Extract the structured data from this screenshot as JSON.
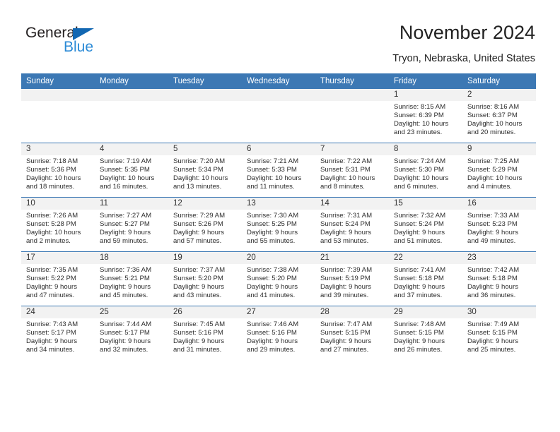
{
  "brand": {
    "name_part1": "General",
    "name_part2": "Blue",
    "triangle_icon": "triangle-icon",
    "accent_color": "#1267b2",
    "secondary_color": "#2b8ad6"
  },
  "header": {
    "title": "November 2024",
    "subtitle": "Tryon, Nebraska, United States"
  },
  "theme": {
    "header_blue": "#3c78b4",
    "day_strip_gray": "#f2f2f2",
    "text_color": "#2d2d2d"
  },
  "weekdays": [
    "Sunday",
    "Monday",
    "Tuesday",
    "Wednesday",
    "Thursday",
    "Friday",
    "Saturday"
  ],
  "weeks": [
    [
      {
        "day": "",
        "sunrise": "",
        "sunset": "",
        "daylight_line1": "",
        "daylight_line2": "",
        "empty": true
      },
      {
        "day": "",
        "sunrise": "",
        "sunset": "",
        "daylight_line1": "",
        "daylight_line2": "",
        "empty": true
      },
      {
        "day": "",
        "sunrise": "",
        "sunset": "",
        "daylight_line1": "",
        "daylight_line2": "",
        "empty": true
      },
      {
        "day": "",
        "sunrise": "",
        "sunset": "",
        "daylight_line1": "",
        "daylight_line2": "",
        "empty": true
      },
      {
        "day": "",
        "sunrise": "",
        "sunset": "",
        "daylight_line1": "",
        "daylight_line2": "",
        "empty": true
      },
      {
        "day": "1",
        "sunrise": "Sunrise: 8:15 AM",
        "sunset": "Sunset: 6:39 PM",
        "daylight_line1": "Daylight: 10 hours",
        "daylight_line2": "and 23 minutes."
      },
      {
        "day": "2",
        "sunrise": "Sunrise: 8:16 AM",
        "sunset": "Sunset: 6:37 PM",
        "daylight_line1": "Daylight: 10 hours",
        "daylight_line2": "and 20 minutes."
      }
    ],
    [
      {
        "day": "3",
        "sunrise": "Sunrise: 7:18 AM",
        "sunset": "Sunset: 5:36 PM",
        "daylight_line1": "Daylight: 10 hours",
        "daylight_line2": "and 18 minutes."
      },
      {
        "day": "4",
        "sunrise": "Sunrise: 7:19 AM",
        "sunset": "Sunset: 5:35 PM",
        "daylight_line1": "Daylight: 10 hours",
        "daylight_line2": "and 16 minutes."
      },
      {
        "day": "5",
        "sunrise": "Sunrise: 7:20 AM",
        "sunset": "Sunset: 5:34 PM",
        "daylight_line1": "Daylight: 10 hours",
        "daylight_line2": "and 13 minutes."
      },
      {
        "day": "6",
        "sunrise": "Sunrise: 7:21 AM",
        "sunset": "Sunset: 5:33 PM",
        "daylight_line1": "Daylight: 10 hours",
        "daylight_line2": "and 11 minutes."
      },
      {
        "day": "7",
        "sunrise": "Sunrise: 7:22 AM",
        "sunset": "Sunset: 5:31 PM",
        "daylight_line1": "Daylight: 10 hours",
        "daylight_line2": "and 8 minutes."
      },
      {
        "day": "8",
        "sunrise": "Sunrise: 7:24 AM",
        "sunset": "Sunset: 5:30 PM",
        "daylight_line1": "Daylight: 10 hours",
        "daylight_line2": "and 6 minutes."
      },
      {
        "day": "9",
        "sunrise": "Sunrise: 7:25 AM",
        "sunset": "Sunset: 5:29 PM",
        "daylight_line1": "Daylight: 10 hours",
        "daylight_line2": "and 4 minutes."
      }
    ],
    [
      {
        "day": "10",
        "sunrise": "Sunrise: 7:26 AM",
        "sunset": "Sunset: 5:28 PM",
        "daylight_line1": "Daylight: 10 hours",
        "daylight_line2": "and 2 minutes."
      },
      {
        "day": "11",
        "sunrise": "Sunrise: 7:27 AM",
        "sunset": "Sunset: 5:27 PM",
        "daylight_line1": "Daylight: 9 hours",
        "daylight_line2": "and 59 minutes."
      },
      {
        "day": "12",
        "sunrise": "Sunrise: 7:29 AM",
        "sunset": "Sunset: 5:26 PM",
        "daylight_line1": "Daylight: 9 hours",
        "daylight_line2": "and 57 minutes."
      },
      {
        "day": "13",
        "sunrise": "Sunrise: 7:30 AM",
        "sunset": "Sunset: 5:25 PM",
        "daylight_line1": "Daylight: 9 hours",
        "daylight_line2": "and 55 minutes."
      },
      {
        "day": "14",
        "sunrise": "Sunrise: 7:31 AM",
        "sunset": "Sunset: 5:24 PM",
        "daylight_line1": "Daylight: 9 hours",
        "daylight_line2": "and 53 minutes."
      },
      {
        "day": "15",
        "sunrise": "Sunrise: 7:32 AM",
        "sunset": "Sunset: 5:24 PM",
        "daylight_line1": "Daylight: 9 hours",
        "daylight_line2": "and 51 minutes."
      },
      {
        "day": "16",
        "sunrise": "Sunrise: 7:33 AM",
        "sunset": "Sunset: 5:23 PM",
        "daylight_line1": "Daylight: 9 hours",
        "daylight_line2": "and 49 minutes."
      }
    ],
    [
      {
        "day": "17",
        "sunrise": "Sunrise: 7:35 AM",
        "sunset": "Sunset: 5:22 PM",
        "daylight_line1": "Daylight: 9 hours",
        "daylight_line2": "and 47 minutes."
      },
      {
        "day": "18",
        "sunrise": "Sunrise: 7:36 AM",
        "sunset": "Sunset: 5:21 PM",
        "daylight_line1": "Daylight: 9 hours",
        "daylight_line2": "and 45 minutes."
      },
      {
        "day": "19",
        "sunrise": "Sunrise: 7:37 AM",
        "sunset": "Sunset: 5:20 PM",
        "daylight_line1": "Daylight: 9 hours",
        "daylight_line2": "and 43 minutes."
      },
      {
        "day": "20",
        "sunrise": "Sunrise: 7:38 AM",
        "sunset": "Sunset: 5:20 PM",
        "daylight_line1": "Daylight: 9 hours",
        "daylight_line2": "and 41 minutes."
      },
      {
        "day": "21",
        "sunrise": "Sunrise: 7:39 AM",
        "sunset": "Sunset: 5:19 PM",
        "daylight_line1": "Daylight: 9 hours",
        "daylight_line2": "and 39 minutes."
      },
      {
        "day": "22",
        "sunrise": "Sunrise: 7:41 AM",
        "sunset": "Sunset: 5:18 PM",
        "daylight_line1": "Daylight: 9 hours",
        "daylight_line2": "and 37 minutes."
      },
      {
        "day": "23",
        "sunrise": "Sunrise: 7:42 AM",
        "sunset": "Sunset: 5:18 PM",
        "daylight_line1": "Daylight: 9 hours",
        "daylight_line2": "and 36 minutes."
      }
    ],
    [
      {
        "day": "24",
        "sunrise": "Sunrise: 7:43 AM",
        "sunset": "Sunset: 5:17 PM",
        "daylight_line1": "Daylight: 9 hours",
        "daylight_line2": "and 34 minutes."
      },
      {
        "day": "25",
        "sunrise": "Sunrise: 7:44 AM",
        "sunset": "Sunset: 5:17 PM",
        "daylight_line1": "Daylight: 9 hours",
        "daylight_line2": "and 32 minutes."
      },
      {
        "day": "26",
        "sunrise": "Sunrise: 7:45 AM",
        "sunset": "Sunset: 5:16 PM",
        "daylight_line1": "Daylight: 9 hours",
        "daylight_line2": "and 31 minutes."
      },
      {
        "day": "27",
        "sunrise": "Sunrise: 7:46 AM",
        "sunset": "Sunset: 5:16 PM",
        "daylight_line1": "Daylight: 9 hours",
        "daylight_line2": "and 29 minutes."
      },
      {
        "day": "28",
        "sunrise": "Sunrise: 7:47 AM",
        "sunset": "Sunset: 5:15 PM",
        "daylight_line1": "Daylight: 9 hours",
        "daylight_line2": "and 27 minutes."
      },
      {
        "day": "29",
        "sunrise": "Sunrise: 7:48 AM",
        "sunset": "Sunset: 5:15 PM",
        "daylight_line1": "Daylight: 9 hours",
        "daylight_line2": "and 26 minutes."
      },
      {
        "day": "30",
        "sunrise": "Sunrise: 7:49 AM",
        "sunset": "Sunset: 5:15 PM",
        "daylight_line1": "Daylight: 9 hours",
        "daylight_line2": "and 25 minutes."
      }
    ]
  ]
}
